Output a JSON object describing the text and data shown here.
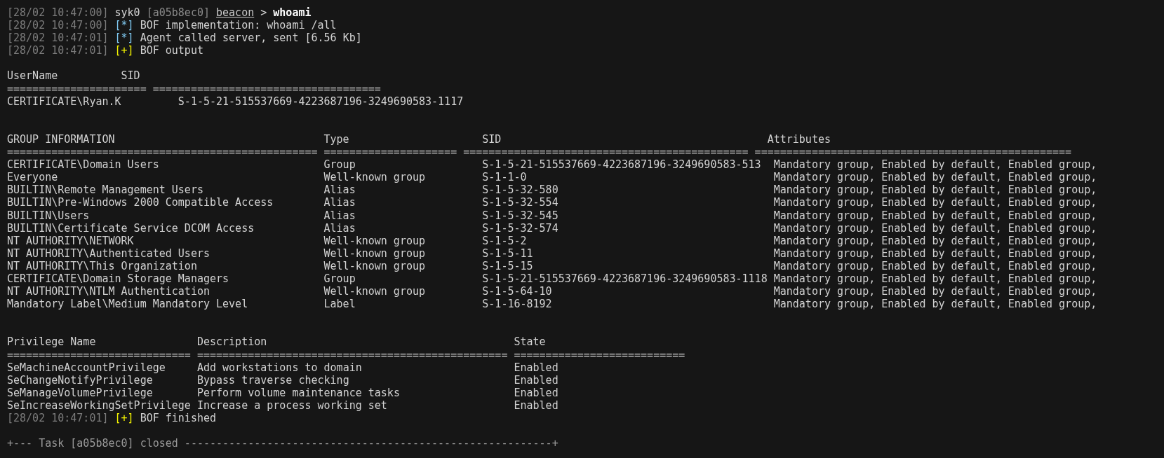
{
  "log_lines": [
    {
      "kind": "prompt",
      "timestamp": "[28/02 10:47:00]",
      "user": "syk0",
      "task_id": "[a05b8ec0]",
      "target": "beacon",
      "separator": ">",
      "command": "whoami"
    },
    {
      "kind": "info",
      "timestamp": "[28/02 10:47:00]",
      "marker": "[*]",
      "message": "BOF implementation: whoami /all"
    },
    {
      "kind": "info",
      "timestamp": "[28/02 10:47:01]",
      "marker": "[*]",
      "message": "Agent called server, sent [6.56 Kb]"
    },
    {
      "kind": "success",
      "timestamp": "[28/02 10:47:01]",
      "marker": "[+]",
      "message": "BOF output"
    }
  ],
  "user_table": {
    "columns": [
      {
        "label": "UserName",
        "rule": "======================"
      },
      {
        "label": "SID",
        "rule": "===================================="
      }
    ],
    "rows": [
      [
        "CERTIFICATE\\Ryan.K",
        "S-1-5-21-515537669-4223687196-3249690583-1117"
      ]
    ]
  },
  "group_table": {
    "columns": [
      {
        "label": "GROUP INFORMATION",
        "rule": "================================================="
      },
      {
        "label": "Type",
        "rule": "====================="
      },
      {
        "label": "SID",
        "rule": "============================================="
      },
      {
        "label": "Attributes",
        "rule": "=================================================="
      }
    ],
    "rows": [
      [
        "CERTIFICATE\\Domain Users",
        "Group",
        "S-1-5-21-515537669-4223687196-3249690583-513",
        "Mandatory group, Enabled by default, Enabled group,"
      ],
      [
        "Everyone",
        "Well-known group",
        "S-1-1-0",
        "Mandatory group, Enabled by default, Enabled group,"
      ],
      [
        "BUILTIN\\Remote Management Users",
        "Alias",
        "S-1-5-32-580",
        "Mandatory group, Enabled by default, Enabled group,"
      ],
      [
        "BUILTIN\\Pre-Windows 2000 Compatible Access",
        "Alias",
        "S-1-5-32-554",
        "Mandatory group, Enabled by default, Enabled group,"
      ],
      [
        "BUILTIN\\Users",
        "Alias",
        "S-1-5-32-545",
        "Mandatory group, Enabled by default, Enabled group,"
      ],
      [
        "BUILTIN\\Certificate Service DCOM Access",
        "Alias",
        "S-1-5-32-574",
        "Mandatory group, Enabled by default, Enabled group,"
      ],
      [
        "NT AUTHORITY\\NETWORK",
        "Well-known group",
        "S-1-5-2",
        "Mandatory group, Enabled by default, Enabled group,"
      ],
      [
        "NT AUTHORITY\\Authenticated Users",
        "Well-known group",
        "S-1-5-11",
        "Mandatory group, Enabled by default, Enabled group,"
      ],
      [
        "NT AUTHORITY\\This Organization",
        "Well-known group",
        "S-1-5-15",
        "Mandatory group, Enabled by default, Enabled group,"
      ],
      [
        "CERTIFICATE\\Domain Storage Managers",
        "Group",
        "S-1-5-21-515537669-4223687196-3249690583-1118",
        "Mandatory group, Enabled by default, Enabled group,"
      ],
      [
        "NT AUTHORITY\\NTLM Authentication",
        "Well-known group",
        "S-1-5-64-10",
        "Mandatory group, Enabled by default, Enabled group,"
      ],
      [
        "Mandatory Label\\Medium Mandatory Level",
        "Label",
        "S-1-16-8192",
        "Mandatory group, Enabled by default, Enabled group,"
      ]
    ]
  },
  "privilege_table": {
    "columns": [
      {
        "label": "Privilege Name",
        "rule": "============================="
      },
      {
        "label": "Description",
        "rule": "================================================="
      },
      {
        "label": "State",
        "rule": "==========================="
      }
    ],
    "rows": [
      [
        "SeMachineAccountPrivilege",
        "Add workstations to domain",
        "Enabled"
      ],
      [
        "SeChangeNotifyPrivilege",
        "Bypass traverse checking",
        "Enabled"
      ],
      [
        "SeManageVolumePrivilege",
        "Perform volume maintenance tasks",
        "Enabled"
      ],
      [
        "SeIncreaseWorkingSetPrivilege",
        "Increase a process working set",
        "Enabled"
      ]
    ]
  },
  "final_lines": [
    {
      "kind": "success",
      "timestamp": "[28/02 10:47:01]",
      "marker": "[+]",
      "message": "BOF finished"
    }
  ],
  "task_footer": "+--- Task [a05b8ec0] closed ----------------------------------------------------------+"
}
